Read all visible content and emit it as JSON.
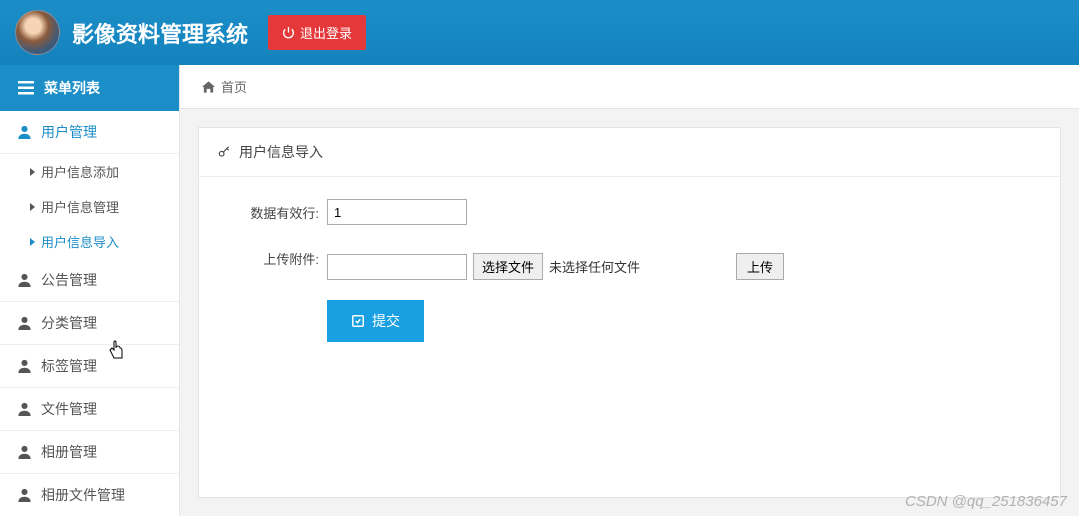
{
  "header": {
    "app_title": "影像资料管理系统",
    "logout_label": "退出登录"
  },
  "sidebar": {
    "menu_header": "菜单列表",
    "items": [
      {
        "label": "用户管理",
        "active": true
      },
      {
        "label": "公告管理"
      },
      {
        "label": "分类管理"
      },
      {
        "label": "标签管理"
      },
      {
        "label": "文件管理"
      },
      {
        "label": "相册管理"
      },
      {
        "label": "相册文件管理"
      }
    ],
    "submenu": [
      {
        "label": "用户信息添加"
      },
      {
        "label": "用户信息管理"
      },
      {
        "label": "用户信息导入",
        "active": true
      }
    ]
  },
  "breadcrumb": {
    "home": "首页"
  },
  "panel": {
    "title": "用户信息导入",
    "form": {
      "row_count_label": "数据有效行:",
      "row_count_value": "1",
      "attachment_label": "上传附件:",
      "choose_file_label": "选择文件",
      "no_file_text": "未选择任何文件",
      "upload_label": "上传",
      "submit_label": "提交"
    }
  },
  "watermark": "CSDN @qq_251836457"
}
